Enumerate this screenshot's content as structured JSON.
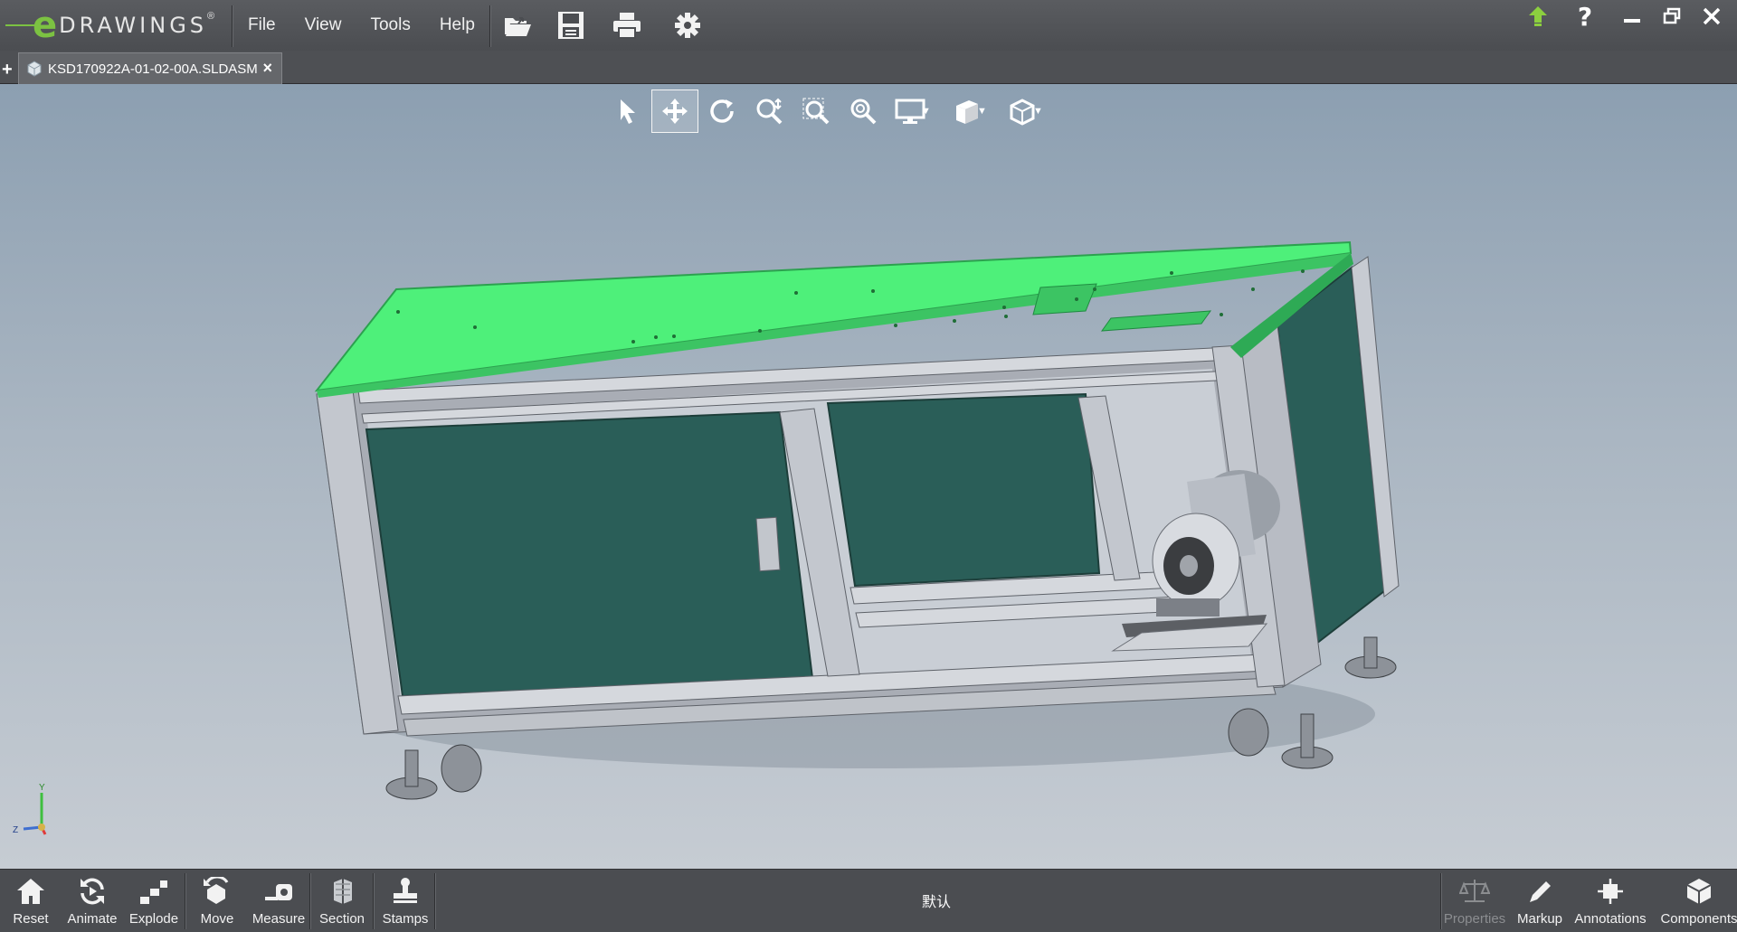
{
  "app": {
    "logo_e": "e",
    "logo_word": "DRAWINGS",
    "logo_mark": "®"
  },
  "menu": [
    "File",
    "View",
    "Tools",
    "Help"
  ],
  "toolbar_icons": [
    "open-icon",
    "save-icon",
    "print-icon",
    "settings-icon"
  ],
  "window_controls": [
    "upload-icon",
    "help-icon",
    "minimize-icon",
    "restore-icon",
    "close-icon"
  ],
  "help_glyph": "?",
  "tab": {
    "title": "KSD170922A-01-02-00A.SLDASM",
    "close": "×",
    "add": "+"
  },
  "view_tools": [
    "select-icon",
    "pan-icon",
    "rotate-icon",
    "zoom-to-fit-icon",
    "zoom-to-area-icon",
    "zoom-icon",
    "display-style-icon",
    "view-orientation-icon",
    "standard-view-icon"
  ],
  "triad": {
    "y": "Y",
    "z": "Z"
  },
  "bottom_tools": [
    {
      "label": "Reset",
      "icon": "home-icon"
    },
    {
      "label": "Animate",
      "icon": "animate-icon"
    },
    {
      "label": "Explode",
      "icon": "explode-icon"
    },
    {
      "label": "Move",
      "icon": "move-icon"
    },
    {
      "label": "Measure",
      "icon": "measure-icon"
    },
    {
      "label": "Section",
      "icon": "section-icon"
    },
    {
      "label": "Stamps",
      "icon": "stamps-icon"
    }
  ],
  "configuration": "默认",
  "right_tools": [
    {
      "label": "Properties",
      "icon": "properties-icon",
      "disabled": true
    },
    {
      "label": "Markup",
      "icon": "markup-icon",
      "disabled": false
    },
    {
      "label": "Annotations",
      "icon": "annotations-icon",
      "disabled": false
    },
    {
      "label": "Components",
      "icon": "components-icon",
      "disabled": false
    }
  ],
  "colors": {
    "brand": "#7cc242",
    "tabletop": "#4ef07a",
    "panel": "#2a5e58",
    "frame": "#b8bcc4"
  }
}
